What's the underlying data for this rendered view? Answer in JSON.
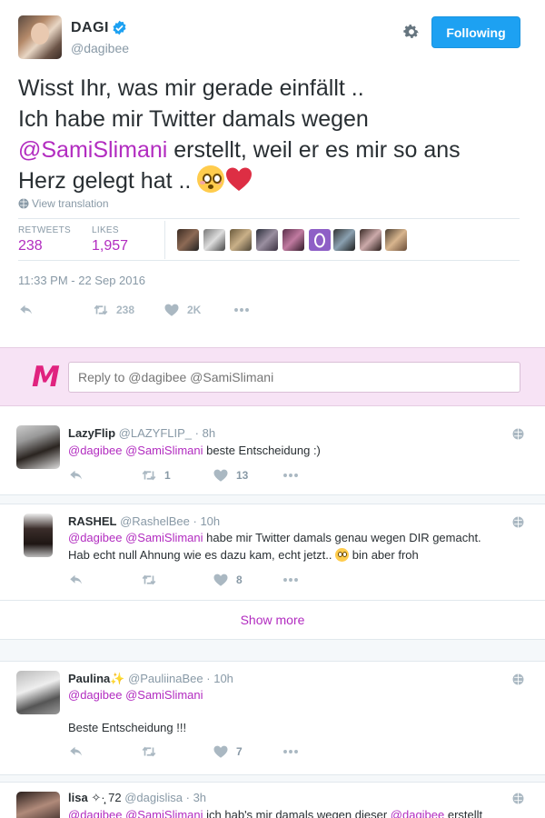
{
  "colors": {
    "accent": "#b22cc0",
    "follow_button": "#1da1f2",
    "reply_bar_bg": "#f7e3f5",
    "logo": "#e0237f",
    "heart": "#dd2e44"
  },
  "tweet": {
    "author_name": "DAGI",
    "author_handle": "@dagibee",
    "follow_label": "Following",
    "text_line1": "Wisst Ihr, was mir gerade einfällt ..",
    "text_line2": "Ich habe mir Twitter damals wegen",
    "text_mention": "@SamiSlimani",
    "text_line3_rest": " erstellt, weil er es mir so ans",
    "text_line4": "Herz gelegt hat .. ",
    "emoji_1": "flushed-face",
    "emoji_2": "red-heart",
    "translate_label": "View translation",
    "retweets_label": "RETWEETS",
    "retweets_value": "238",
    "likes_label": "LIKES",
    "likes_value": "1,957",
    "timestamp": "11:33 PM - 22 Sep 2016",
    "action_retweet_count": "238",
    "action_like_count": "2K"
  },
  "reply_box": {
    "logo_letter": "M",
    "placeholder": "Reply to @dagibee @SamiSlimani"
  },
  "replies": [
    {
      "name": "LazyFlip",
      "handle": "@LAZYFLIP_",
      "time": "· 8h",
      "mentions": "@dagibee @SamiSlimani",
      "text": " beste Entscheidung :)",
      "retweets": "1",
      "likes": "13"
    },
    {
      "name": "RASHEL",
      "handle": "@RashelBee",
      "time": "· 10h",
      "mentions": "@dagibee @SamiSlimani",
      "text": " habe mir Twitter damals genau wegen DIR gemacht.",
      "text2": "Hab echt null Ahnung wie es dazu kam, echt jetzt.. ",
      "text3": " bin aber froh",
      "retweets": "",
      "likes": "8"
    },
    {
      "name": "Paulina",
      "name_suffix": "✨",
      "handle": "@PauliinaBee",
      "time": "· 10h",
      "mentions": "@dagibee @SamiSlimani",
      "text2": "Beste Entscheidung !!!",
      "retweets": "",
      "likes": "7"
    },
    {
      "name": "lisa",
      "name_suffix": "✧·̩͙ 72",
      "handle": "@dagislisa",
      "time": "· 3h",
      "mentions": "@dagibee @SamiSlimani",
      "text": " ich hab's mir damals wegen dieser ",
      "mention2": "@dagibee",
      "text_end": " erstellt"
    }
  ],
  "show_more_label": "Show more"
}
